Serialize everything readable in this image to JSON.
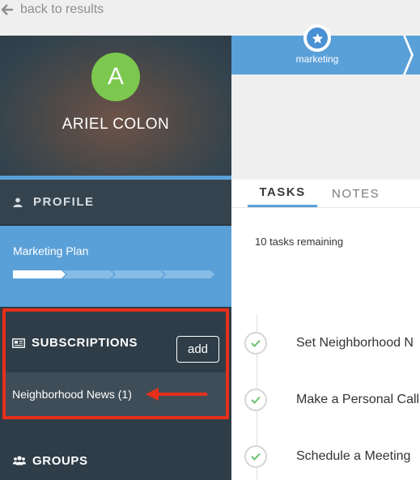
{
  "nav": {
    "back_label": "back to results"
  },
  "contact": {
    "avatar_initial": "A",
    "name": "ARIEL COLON"
  },
  "sidebar": {
    "profile_label": "PROFILE",
    "plan": {
      "title": "Marketing Plan",
      "progress_segments_total": 5,
      "progress_segments_done": 1
    },
    "subscriptions": {
      "label": "SUBSCRIPTIONS",
      "add_label": "add",
      "items": [
        {
          "label": "Neighborhood News (1)"
        }
      ]
    },
    "groups_label": "GROUPS"
  },
  "stage": {
    "label": "marketing"
  },
  "tabs": [
    {
      "label": "TASKS",
      "active": true
    },
    {
      "label": "NOTES",
      "active": false
    }
  ],
  "tasks": {
    "remaining_text": "10 tasks remaining",
    "items": [
      {
        "title": "Set Neighborhood N"
      },
      {
        "title": "Make a Personal Call"
      },
      {
        "title": "Schedule a Meeting"
      }
    ]
  },
  "colors": {
    "sidebar_bg": "#2e3d48",
    "accent_blue": "#5aa0d8",
    "avatar_green": "#7cc84e",
    "highlight_red": "#e5301b",
    "check_green": "#6cc070"
  }
}
